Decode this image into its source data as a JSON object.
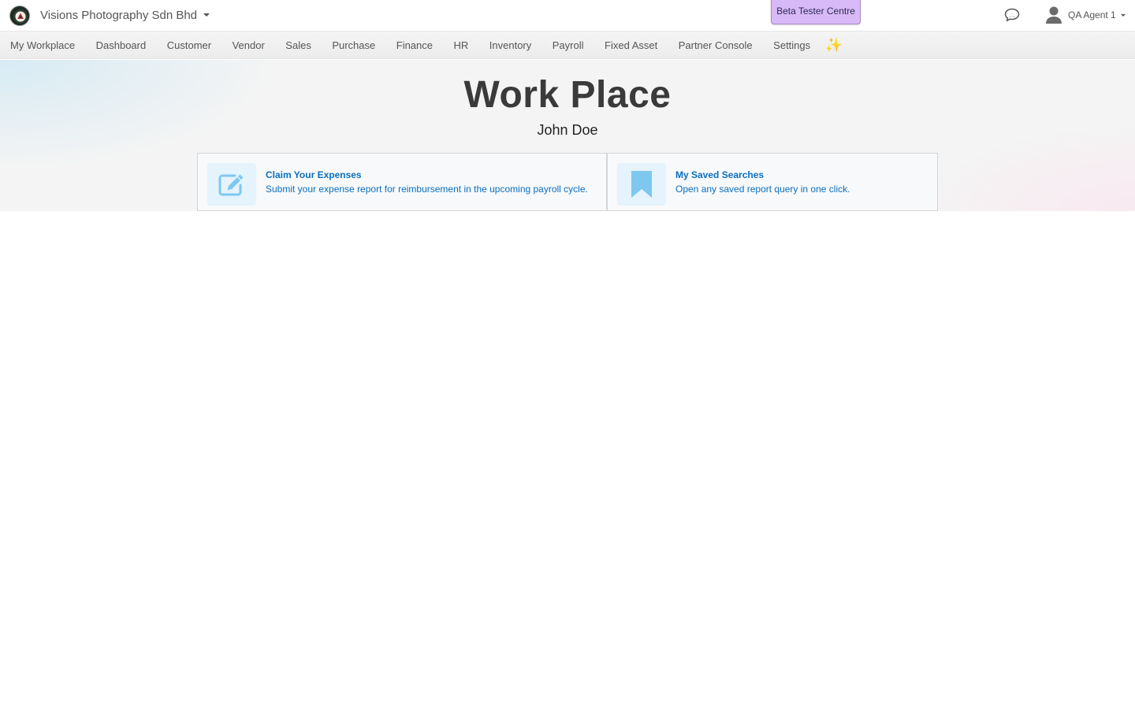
{
  "header": {
    "company_name": "Visions Photography Sdn Bhd",
    "beta_button_label": "Beta Tester Centre",
    "user_name": "QA Agent 1",
    "icons": {
      "logo": "company-logo",
      "chat": "chat-bubble-icon",
      "user": "user-icon"
    }
  },
  "nav": {
    "items": [
      {
        "label": "My Workplace"
      },
      {
        "label": "Dashboard"
      },
      {
        "label": "Customer"
      },
      {
        "label": "Vendor"
      },
      {
        "label": "Sales"
      },
      {
        "label": "Purchase"
      },
      {
        "label": "Finance"
      },
      {
        "label": "HR"
      },
      {
        "label": "Inventory"
      },
      {
        "label": "Payroll"
      },
      {
        "label": "Fixed Asset"
      },
      {
        "label": "Partner Console"
      },
      {
        "label": "Settings"
      }
    ],
    "sparkle_glyph": "✨"
  },
  "main": {
    "title": "Work Place",
    "user_fullname": "John Doe",
    "cards": [
      {
        "title": "Claim Your Expenses",
        "description": "Submit your expense report for reimbursement in the upcoming payroll cycle.",
        "icon": "edit-icon"
      },
      {
        "title": "My Saved Searches",
        "description": "Open any saved report query in one click.",
        "icon": "bookmark-icon"
      }
    ]
  },
  "colors": {
    "beta_button_bg": "#d8b9f7",
    "card_link": "#0a6fbf",
    "card_icon_bg": "#e4f3fc",
    "card_icon": "#7ec8f0",
    "sparkle": "#f6c343"
  }
}
